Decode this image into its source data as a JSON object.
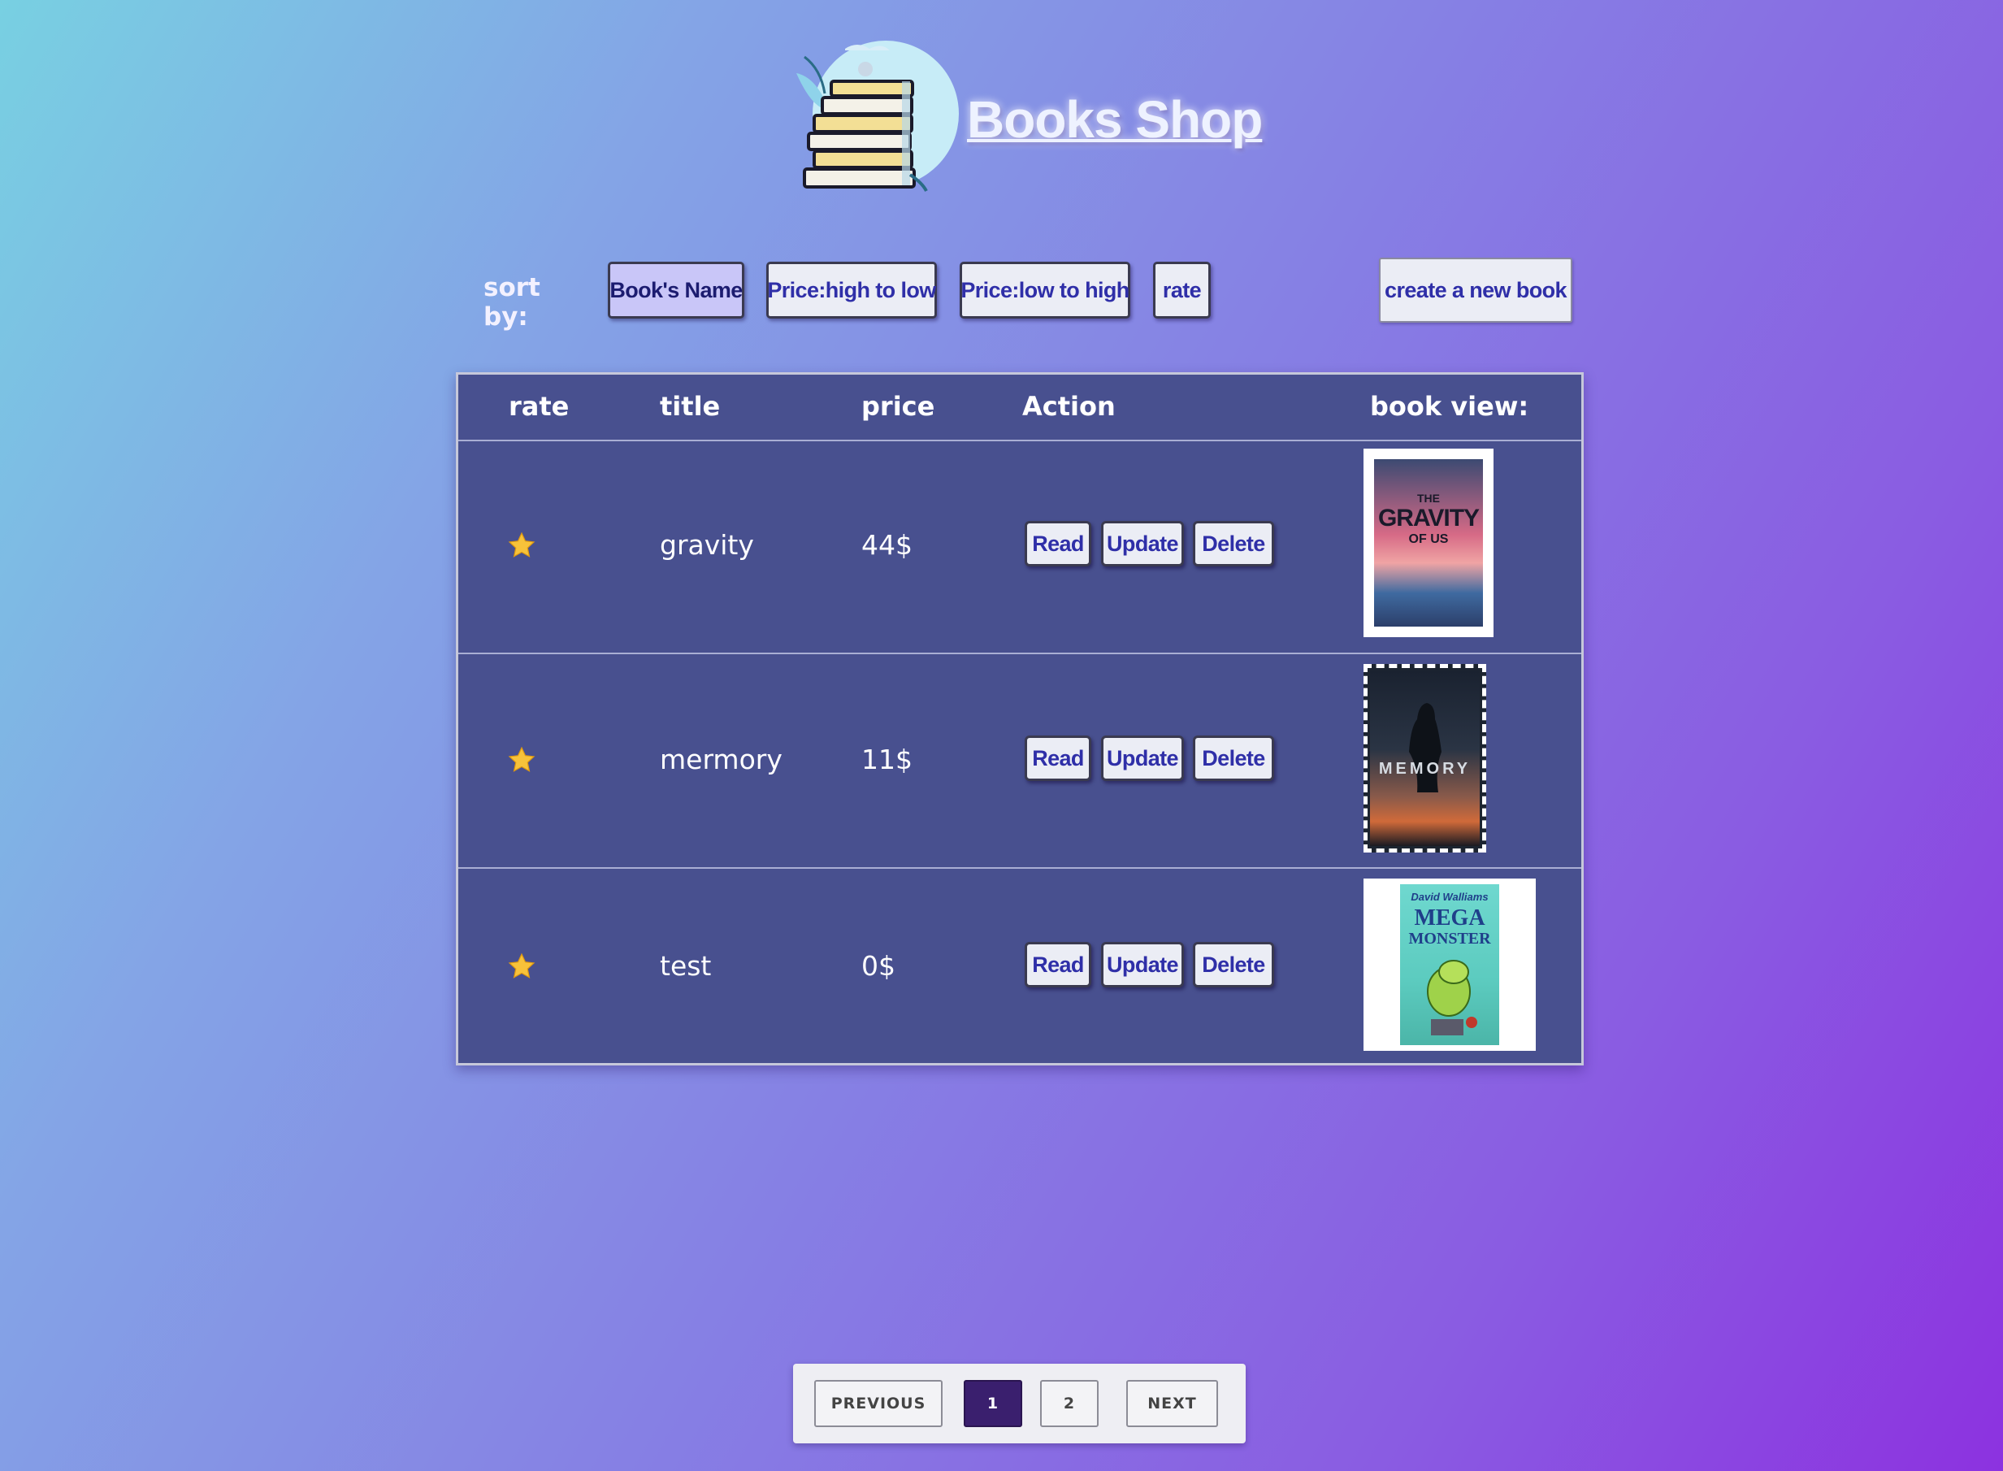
{
  "brand": {
    "title": "Books Shop"
  },
  "sort": {
    "label": "sort by:",
    "options": [
      "Book's Name",
      "Price:high to low",
      "Price:low to high",
      "rate"
    ],
    "active": "Book's Name"
  },
  "create_button": "create a new book",
  "table": {
    "headers": {
      "rate": "rate",
      "title": "title",
      "price": "price",
      "action": "Action",
      "view": "book view:"
    },
    "rows": [
      {
        "title": "gravity",
        "price": "44$",
        "rating_stars": 1,
        "cover_text": [
          "THE",
          "GRAVITY",
          "OF US"
        ]
      },
      {
        "title": "mermory",
        "price": "11$",
        "rating_stars": 1,
        "cover_text": [
          "MEMORY"
        ]
      },
      {
        "title": "test",
        "price": "0$",
        "rating_stars": 1,
        "cover_text": [
          "David Walliams",
          "MEGA",
          "MONSTER"
        ]
      }
    ],
    "actions": {
      "read": "Read",
      "update": "Update",
      "delete": "Delete"
    }
  },
  "pagination": {
    "previous": "PREVIOUS",
    "pages": [
      "1",
      "2"
    ],
    "current": "1",
    "next": "NEXT"
  },
  "colors": {
    "table_bg": "#48508f",
    "button_text": "#2f2fa8",
    "active_page": "#3a1f6e",
    "star": "#f7c23a"
  }
}
